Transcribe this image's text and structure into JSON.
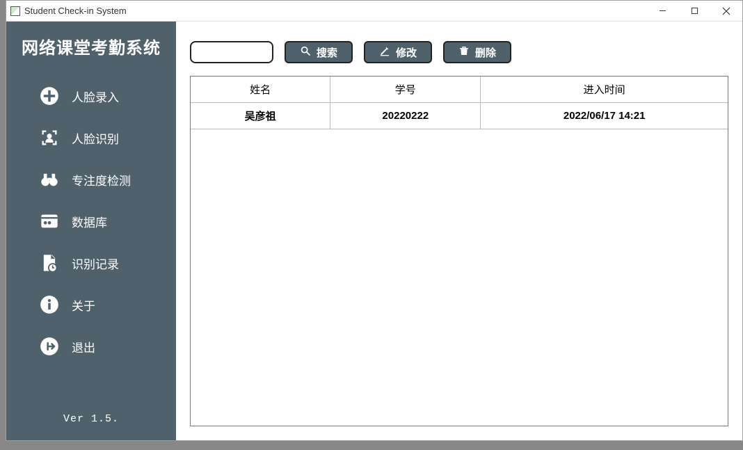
{
  "window": {
    "title": "Student Check-in System"
  },
  "sidebar": {
    "system_title": "网络课堂考勤系统",
    "items": [
      {
        "label": "人脸录入",
        "icon": "plus-circle-icon"
      },
      {
        "label": "人脸识别",
        "icon": "face-scan-icon"
      },
      {
        "label": "专注度检测",
        "icon": "binoculars-icon"
      },
      {
        "label": "数据库",
        "icon": "database-users-icon"
      },
      {
        "label": "识别记录",
        "icon": "document-clock-icon"
      },
      {
        "label": "关于",
        "icon": "info-circle-icon"
      },
      {
        "label": "退出",
        "icon": "logout-circle-icon"
      }
    ],
    "version": "Ver 1.5."
  },
  "toolbar": {
    "search_value": "",
    "search_label": "搜索",
    "edit_label": "修改",
    "delete_label": "删除"
  },
  "table": {
    "headers": {
      "name": "姓名",
      "id": "学号",
      "time": "进入时间"
    },
    "rows": [
      {
        "name": "吴彦祖",
        "id": "20220222",
        "time": "2022/06/17 14:21"
      }
    ]
  }
}
